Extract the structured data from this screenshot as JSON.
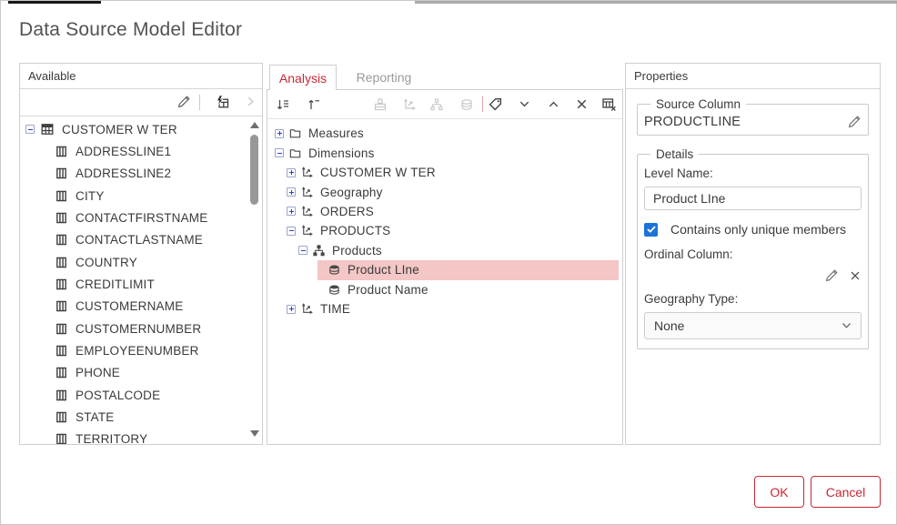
{
  "window": {
    "title": "Data Source Model Editor"
  },
  "available_panel": {
    "title": "Available",
    "toolbar": {
      "edit_icon": "pencil",
      "generate_icon": "lightning-table",
      "add_icon": "chevron-right",
      "add_disabled": true
    },
    "tree": {
      "root": {
        "label": "CUSTOMER W TER",
        "type": "table",
        "state": "expanded"
      },
      "columns": [
        "ADDRESSLINE1",
        "ADDRESSLINE2",
        "CITY",
        "CONTACTFIRSTNAME",
        "CONTACTLASTNAME",
        "COUNTRY",
        "CREDITLIMIT",
        "CUSTOMERNAME",
        "CUSTOMERNUMBER",
        "EMPLOYEENUMBER",
        "PHONE",
        "POSTALCODE",
        "STATE",
        "TERRITORY"
      ]
    }
  },
  "model_panel": {
    "tabs": [
      {
        "label": "Analysis",
        "active": true
      },
      {
        "label": "Reporting",
        "active": false
      }
    ],
    "toolbar": [
      {
        "icon": "reorder-down",
        "disabled": false
      },
      {
        "icon": "reorder-up",
        "disabled": false
      },
      {
        "icon": "add-measure",
        "disabled": true
      },
      {
        "icon": "add-dimension",
        "disabled": true
      },
      {
        "icon": "add-hierarchy",
        "disabled": true
      },
      {
        "icon": "add-level",
        "disabled": true
      },
      {
        "icon": "add-attribute-tag",
        "disabled": false
      },
      {
        "icon": "move-down",
        "disabled": false
      },
      {
        "icon": "move-up",
        "disabled": false
      },
      {
        "icon": "delete",
        "disabled": false
      },
      {
        "icon": "clear-model",
        "disabled": false
      }
    ],
    "tree": [
      {
        "label": "Measures",
        "type": "folder",
        "level": 1,
        "state": "collapsed"
      },
      {
        "label": "Dimensions",
        "type": "folder",
        "level": 1,
        "state": "expanded"
      },
      {
        "label": "CUSTOMER W TER",
        "type": "dimension",
        "level": 2,
        "state": "collapsed"
      },
      {
        "label": "Geography",
        "type": "dimension",
        "level": 2,
        "state": "collapsed"
      },
      {
        "label": "ORDERS",
        "type": "dimension",
        "level": 2,
        "state": "collapsed"
      },
      {
        "label": "PRODUCTS",
        "type": "dimension",
        "level": 2,
        "state": "expanded"
      },
      {
        "label": "Products",
        "type": "hierarchy",
        "level": 3,
        "state": "expanded"
      },
      {
        "label": "Product LIne",
        "type": "level",
        "level": 4,
        "selected": true
      },
      {
        "label": "Product Name",
        "type": "level",
        "level": 4,
        "selected": false
      },
      {
        "label": "TIME",
        "type": "dimension",
        "level": 2,
        "state": "collapsed"
      }
    ]
  },
  "properties_panel": {
    "title": "Properties",
    "source_column": {
      "legend": "Source Column",
      "value": "PRODUCTLINE"
    },
    "details": {
      "legend": "Details",
      "level_name_label": "Level Name:",
      "level_name_value": "Product LIne",
      "unique_members_label": "Contains only unique members",
      "unique_members_checked": true,
      "ordinal_column_label": "Ordinal Column:",
      "geography_type_label": "Geography Type:",
      "geography_type_value": "None"
    }
  },
  "footer": {
    "ok_label": "OK",
    "cancel_label": "Cancel"
  },
  "colors": {
    "accent_red": "#cb2734",
    "selection_pink": "#f4c6c6",
    "checkbox_blue": "#1c73d8",
    "twisty_blue": "#2d3fd0"
  }
}
